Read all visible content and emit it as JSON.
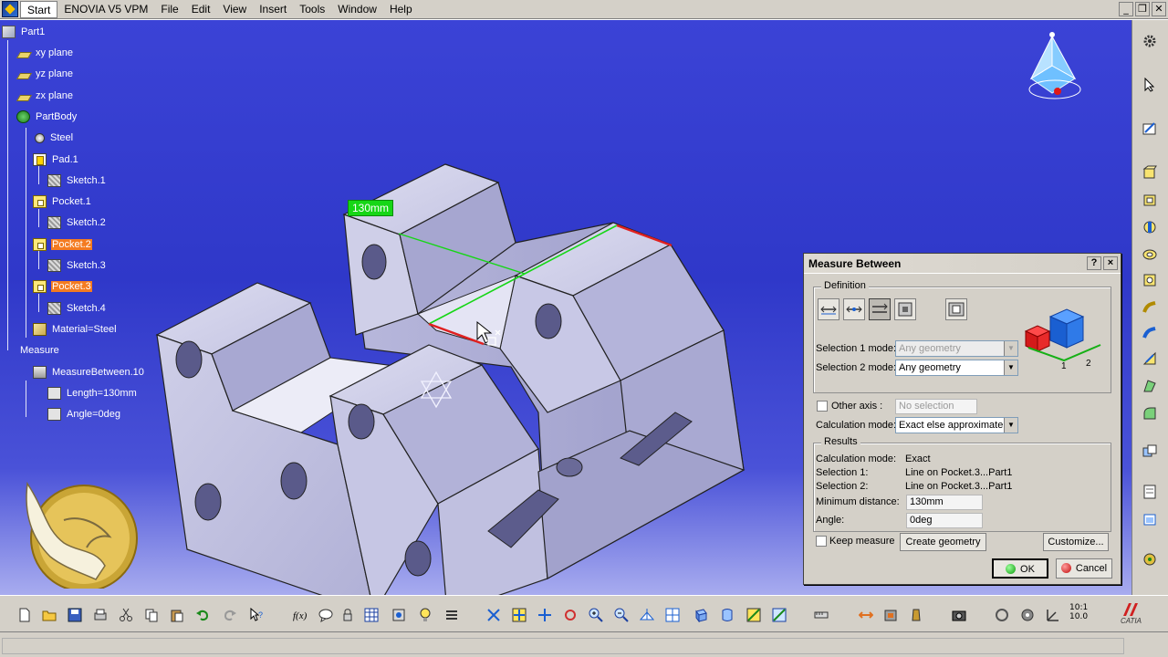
{
  "menubar": {
    "items": [
      "Start",
      "ENOVIA V5 VPM",
      "File",
      "Edit",
      "View",
      "Insert",
      "Tools",
      "Window",
      "Help"
    ]
  },
  "tree": {
    "root": "Part1",
    "planes": [
      "xy plane",
      "yz plane",
      "zx plane"
    ],
    "body": "PartBody",
    "material": "Steel",
    "features": [
      {
        "name": "Pad.1",
        "sketch": "Sketch.1",
        "highlight": false
      },
      {
        "name": "Pocket.1",
        "sketch": "Sketch.2",
        "highlight": false
      },
      {
        "name": "Pocket.2",
        "sketch": "Sketch.3",
        "highlight": true
      },
      {
        "name": "Pocket.3",
        "sketch": "Sketch.4",
        "highlight": true
      }
    ],
    "material_feature": "Material=Steel",
    "measure": "Measure",
    "measure_between": "MeasureBetween.10",
    "length": "Length=130mm",
    "angle": "Angle=0deg"
  },
  "viewport": {
    "dimension_label": "130mm"
  },
  "dialog": {
    "title": "Measure Between",
    "help": "?",
    "close": "×",
    "definition": "Definition",
    "sel1_mode_label": "Selection 1 mode:",
    "sel1_mode_value": "Any geometry",
    "sel2_mode_label": "Selection 2 mode:",
    "sel2_mode_value": "Any geometry",
    "other_axis_label": "Other axis :",
    "other_axis_value": "No selection",
    "calc_mode_label": "Calculation mode:",
    "calc_mode_value": "Exact else approximate",
    "results": "Results",
    "res_calc_label": "Calculation mode:",
    "res_calc_value": "Exact",
    "res_sel1_label": "Selection 1:",
    "res_sel1_value": "Line on Pocket.3...Part1",
    "res_sel2_label": "Selection 2:",
    "res_sel2_value": "Line on Pocket.3...Part1",
    "min_dist_label": "Minimum distance:",
    "min_dist_value": "130mm",
    "angle_label": "Angle:",
    "angle_value": "0deg",
    "keep_measure": "Keep measure",
    "create_geometry": "Create geometry",
    "customize": "Customize...",
    "ok": "OK",
    "cancel": "Cancel",
    "badge_1": "1",
    "badge_2": "2"
  },
  "bottom": {
    "zoom_label_1": "10:1",
    "zoom_label_2": "10.0",
    "brand": "CATIA"
  },
  "colors": {
    "viewport_top": "#3b43d6",
    "highlight": "#f47b20",
    "measure_green": "#16d616",
    "edge_red": "#e02020",
    "part_face": "#c9c9e6"
  }
}
